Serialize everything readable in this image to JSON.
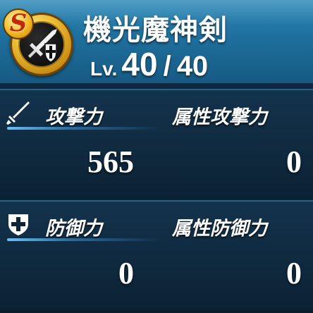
{
  "item": {
    "rank": "S",
    "name": "機光魔神剣",
    "level_label": "Lv.",
    "level_current": "40",
    "level_separator": "/",
    "level_max": "40"
  },
  "stats": {
    "attack": {
      "label": "攻撃力",
      "value": "565"
    },
    "elemental_attack": {
      "label": "属性攻撃力",
      "value": "0"
    },
    "defense": {
      "label": "防御力",
      "value": "0"
    },
    "elemental_defense": {
      "label": "属性防御力",
      "value": "0"
    }
  },
  "icons": {
    "badge": "sword-shield-icon",
    "attack": "sword-icon",
    "defense": "shield-plus-icon"
  },
  "colors": {
    "header": "#1f6f9d",
    "panel": "#0d2438",
    "badge_gold": "#f0c23a",
    "rank_red": "#c4270e",
    "accent_glow": "#6ec8ff",
    "text": "#ffffff"
  }
}
